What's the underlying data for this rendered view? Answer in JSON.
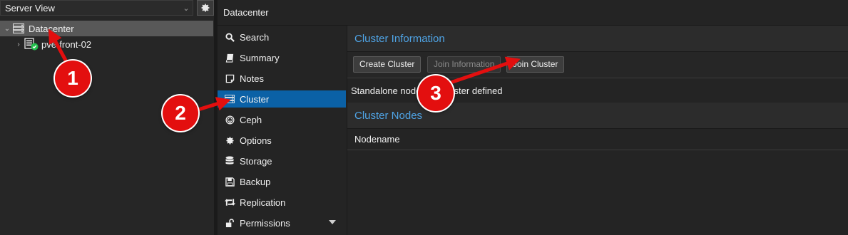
{
  "tree": {
    "view_label": "Server View",
    "items": [
      {
        "label": "Datacenter",
        "icon": "datacenter-icon"
      },
      {
        "label": "pve-front-02",
        "icon": "server-online-icon"
      }
    ]
  },
  "header": {
    "title": "Datacenter"
  },
  "nav": {
    "items": [
      {
        "label": "Search",
        "icon": "search-icon"
      },
      {
        "label": "Summary",
        "icon": "book-icon"
      },
      {
        "label": "Notes",
        "icon": "notes-icon"
      },
      {
        "label": "Cluster",
        "icon": "cluster-icon"
      },
      {
        "label": "Ceph",
        "icon": "ceph-icon"
      },
      {
        "label": "Options",
        "icon": "gear-icon"
      },
      {
        "label": "Storage",
        "icon": "database-icon"
      },
      {
        "label": "Backup",
        "icon": "floppy-icon"
      },
      {
        "label": "Replication",
        "icon": "retweet-icon"
      },
      {
        "label": "Permissions",
        "icon": "unlock-icon"
      }
    ]
  },
  "cluster_info": {
    "title": "Cluster Information",
    "buttons": {
      "create": "Create Cluster",
      "join_info": "Join Information",
      "join": "Join Cluster"
    },
    "status_text": "Standalone node - no cluster defined"
  },
  "cluster_nodes": {
    "title": "Cluster Nodes",
    "columns": [
      "Nodename"
    ]
  },
  "annotations": {
    "step1": "1",
    "step2": "2",
    "step3": "3"
  },
  "colors": {
    "accent": "#0b61a6",
    "heading": "#4fa4e6",
    "annotation_red": "#e30f0f",
    "online_green": "#21bf4b"
  }
}
